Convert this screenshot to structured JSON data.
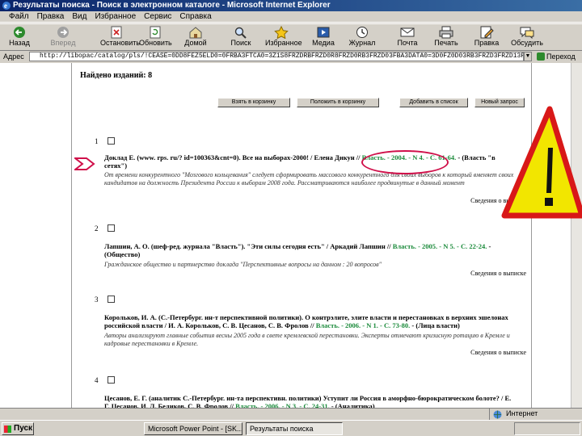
{
  "window": {
    "title": "Результаты поиска - Поиск в электронном каталоге - Microsoft Internet Explorer"
  },
  "menu": [
    "Файл",
    "Правка",
    "Вид",
    "Избранное",
    "Сервис",
    "Справка"
  ],
  "toolbar": [
    {
      "label": "Назад",
      "icon": "back-arrow-icon",
      "enabled": true
    },
    {
      "label": "Вперед",
      "icon": "forward-arrow-icon",
      "enabled": false
    },
    {
      "label": "Остановить",
      "icon": "stop-icon",
      "enabled": true
    },
    {
      "label": "Обновить",
      "icon": "refresh-icon",
      "enabled": true
    },
    {
      "label": "Домой",
      "icon": "home-icon",
      "enabled": true
    },
    {
      "label": "Поиск",
      "icon": "search-icon",
      "enabled": true
    },
    {
      "label": "Избранное",
      "icon": "favorites-icon",
      "enabled": true
    },
    {
      "label": "Медиа",
      "icon": "media-icon",
      "enabled": true
    },
    {
      "label": "Журнал",
      "icon": "history-icon",
      "enabled": true
    },
    {
      "label": "Почта",
      "icon": "mail-icon",
      "enabled": true
    },
    {
      "label": "Печать",
      "icon": "print-icon",
      "enabled": true
    },
    {
      "label": "Правка",
      "icon": "edit-icon",
      "enabled": true
    },
    {
      "label": "Обсудить",
      "icon": "discuss-icon",
      "enabled": true
    }
  ],
  "address": {
    "label": "Адрес",
    "value": "http://libopac/catalog/pls/!CEASE=0DD8FEZ5ELD0=0FRBA3FTCA0=3Z1S8FRZDRBFRZD0R8FRZD0RB3FRZD03FBA3DATA0=3D0FZ0D03RB3FRZD3FRZD13F12",
    "go_label": "Переход"
  },
  "results": {
    "found_label": "Найдено изданий: 8",
    "buttons": [
      "Взять в корзинку",
      "Положить в корзинку",
      "Добавить в список",
      "Новый запрос"
    ],
    "records": [
      {
        "num": "1",
        "author": "Доклад Е.",
        "text": "(www. rps. ru/? id=100363&cnt=0). Все на выборах-2000! / Елена Дикун //",
        "source": "Власть. - 2004. - N 4. - С. 61-64.",
        "tail": "- (Власть \"в сетях\")",
        "annotation": "От времени конкурентного \"Мозгового кольцевания\" следует сформировать массового конкурентного для своих выборов к который вменяет своих кандидатов на должность Президента России к выборам 2008 года. Рассматриваются наиболее продвинутые в данный момент",
        "more": "Сведения о выписке"
      },
      {
        "num": "2",
        "author": "Лапшин, А. О.",
        "text": "(шеф-ред. журнала \"Власть\"). \"Эти силы сегодня есть\" / Аркадий Лапшин //",
        "source": "Власть. - 2005. - N 5. - С. 22-24.",
        "tail": "- (Общество)",
        "annotation": "Гражданское общество и партнерство доклада \"Перспективные вопросы на данном : 20 вопросов\"",
        "more": "Сведения о выписке"
      },
      {
        "num": "3",
        "author": "Корольков, И. А.",
        "text": "(С.-Петербург. ин-т перспективной политики). О контрэлите, элите власти и перестановках в верхних эшелонах российской власти / И. А. Корольков, С. В. Цесанов, С. В. Фролов //",
        "source": "Власть. - 2006. - N 1. - С. 73-80.",
        "tail": "- (Лица власти)",
        "annotation": "Авторы анализируют главные события весны 2005 года в свете кремлевской перестановки. Эксперты отмечают кризисную ротацию в Кремле и кадровые перестановки в Кремле.",
        "more": "Сведения о выписке"
      },
      {
        "num": "4",
        "author": "Цесанов, Е. Г.",
        "text": "(аналитик С.-Петербург. ин-та перспективн. политики) Уступит ли Россия в аморфно-бюрократическом болоте? / Е. Г. Цесанов, И. Л. Беликов, С. В. Фролов //",
        "source": "Власть. - 2006. - N 3. - С. 24-31.",
        "tail": "- (Аналитика)",
        "annotation": "",
        "more": ""
      }
    ]
  },
  "status": {
    "left": "",
    "zone": "Интернет"
  },
  "taskbar": {
    "start": "Пуск",
    "tasks": [
      "Microsoft Power Point - [SK...",
      "Результаты поиска"
    ],
    "clock": ""
  }
}
